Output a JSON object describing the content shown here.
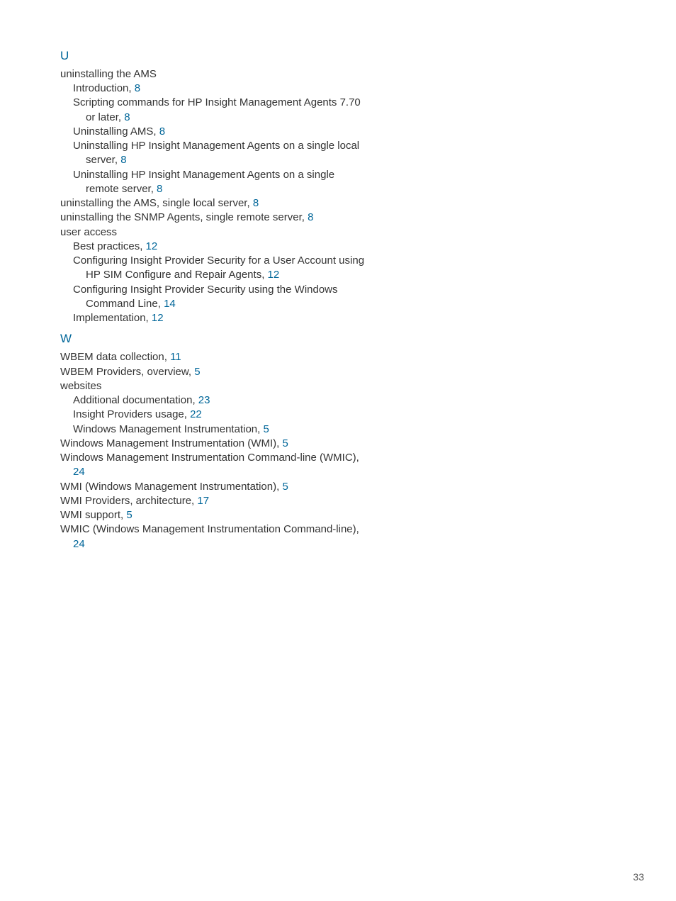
{
  "page_number": "33",
  "sections": {
    "U": {
      "letter": "U",
      "e0": {
        "t": "uninstalling the AMS"
      },
      "e0_s0": {
        "t": "Introduction,",
        "p": "8"
      },
      "e0_s1": {
        "t": "Scripting commands for HP Insight Management Agents 7.70 or later,",
        "p": "8"
      },
      "e0_s2": {
        "t": "Uninstalling AMS,",
        "p": "8"
      },
      "e0_s3": {
        "t": "Uninstalling HP Insight Management Agents on a single local server,",
        "p": "8"
      },
      "e0_s4": {
        "t": "Uninstalling HP Insight Management Agents on a single remote server,",
        "p": "8"
      },
      "e1": {
        "t": "uninstalling the AMS, single local server,",
        "p": "8"
      },
      "e2": {
        "t": "uninstalling the SNMP Agents, single remote server,",
        "p": "8"
      },
      "e3": {
        "t": "user access"
      },
      "e3_s0": {
        "t": "Best practices,",
        "p": "12"
      },
      "e3_s1": {
        "t": "Configuring Insight Provider Security for a User Account using HP SIM Configure and Repair Agents,",
        "p": "12"
      },
      "e3_s2": {
        "t": "Configuring Insight Provider Security using the Windows Command Line,",
        "p": "14"
      },
      "e3_s3": {
        "t": "Implementation,",
        "p": "12"
      }
    },
    "W": {
      "letter": "W",
      "e0": {
        "t": "WBEM data collection,",
        "p": "11"
      },
      "e1": {
        "t": "WBEM Providers, overview,",
        "p": "5"
      },
      "e2": {
        "t": "websites"
      },
      "e2_s0": {
        "t": "Additional documentation,",
        "p": "23"
      },
      "e2_s1": {
        "t": "Insight Providers usage,",
        "p": "22"
      },
      "e2_s2": {
        "t": "Windows Management Instrumentation,",
        "p": "5"
      },
      "e3": {
        "t": "Windows Management Instrumentation (WMI),",
        "p": "5"
      },
      "e4": {
        "t": "Windows Management Instrumentation Command-line (WMIC),",
        "p": "24"
      },
      "e5": {
        "t": "WMI (Windows Management Instrumentation),",
        "p": "5"
      },
      "e6": {
        "t": "WMI Providers, architecture,",
        "p": "17"
      },
      "e7": {
        "t": "WMI support,",
        "p": "5"
      },
      "e8": {
        "t": "WMIC (Windows Management Instrumentation Command-line),",
        "p": "24"
      }
    }
  }
}
